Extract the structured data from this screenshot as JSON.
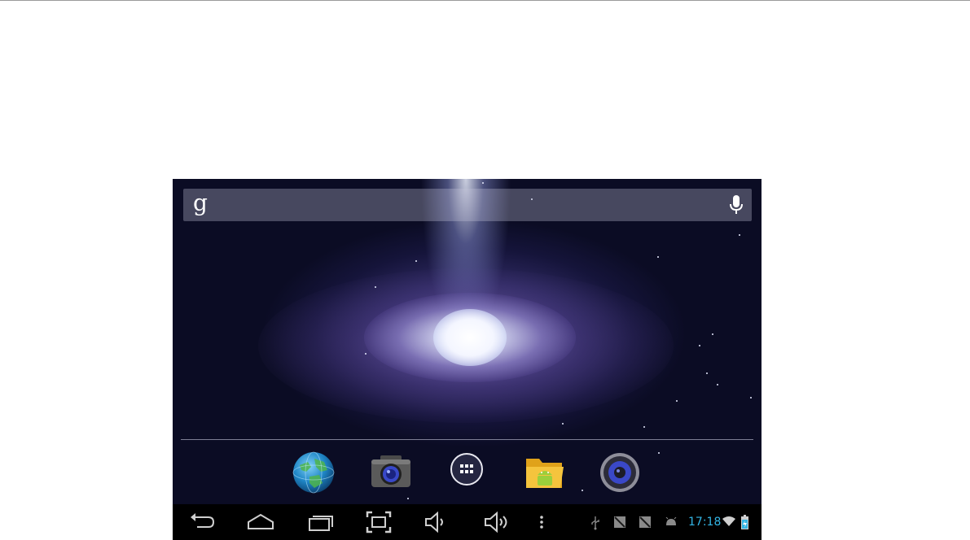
{
  "search_bar": {
    "logo": "g",
    "mic_icon": "microphone-icon"
  },
  "dock": {
    "items": [
      {
        "name": "browser",
        "icon": "globe-icon"
      },
      {
        "name": "camera",
        "icon": "camera-icon"
      },
      {
        "name": "all-apps",
        "icon": "app-drawer-icon"
      },
      {
        "name": "file-manager",
        "icon": "folder-android-icon"
      },
      {
        "name": "music",
        "icon": "speaker-icon"
      }
    ]
  },
  "nav_bar": {
    "buttons": [
      {
        "name": "back",
        "icon": "back-arrow-icon"
      },
      {
        "name": "home",
        "icon": "home-icon"
      },
      {
        "name": "recent-apps",
        "icon": "recents-icon"
      },
      {
        "name": "screenshot",
        "icon": "screenshot-icon"
      },
      {
        "name": "volume-down",
        "icon": "volume-down-icon"
      },
      {
        "name": "volume-up",
        "icon": "volume-up-icon"
      },
      {
        "name": "menu",
        "icon": "overflow-menu-icon"
      }
    ]
  },
  "status_bar": {
    "clock": "17:18",
    "icons": [
      "usb-icon",
      "no-sim-icon",
      "no-sim-icon",
      "android-debug-icon",
      "wifi-icon",
      "battery-charging-icon"
    ],
    "accent_color": "#33b5e5"
  }
}
